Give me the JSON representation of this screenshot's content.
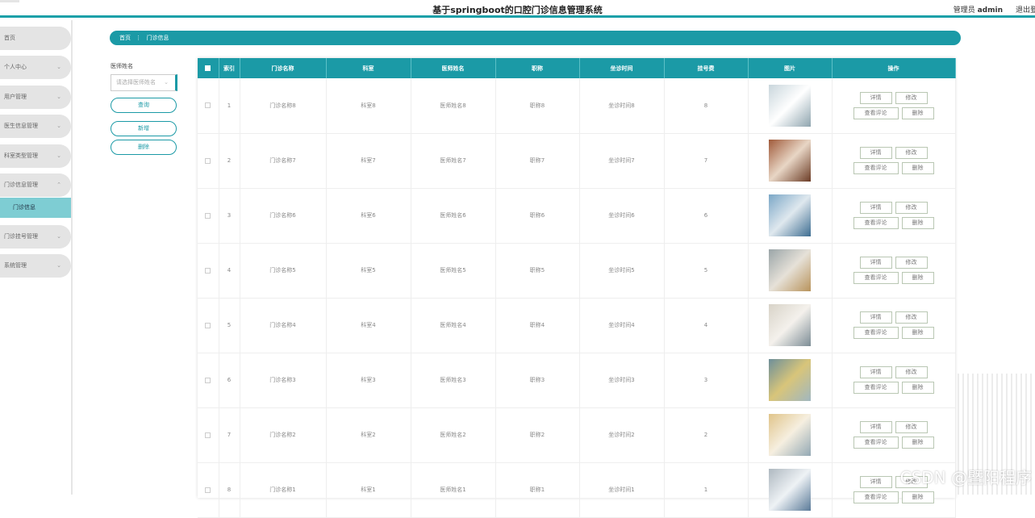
{
  "header": {
    "title": "基于springboot的口腔门诊信息管理系统",
    "admin_role": "管理员",
    "admin_name": "admin",
    "logout": "退出登录"
  },
  "sidebar": {
    "items": [
      {
        "label": "首页"
      },
      {
        "label": "个人中心"
      },
      {
        "label": "用户管理"
      },
      {
        "label": "医生信息管理"
      },
      {
        "label": "科室类型管理"
      },
      {
        "label": "门诊信息管理"
      },
      {
        "label": "门诊挂号管理"
      },
      {
        "label": "系统管理"
      }
    ],
    "active_sub": "门诊信息"
  },
  "breadcrumb": {
    "home": "首页",
    "sep": "⋮",
    "current": "门诊信息"
  },
  "filter": {
    "label": "医师姓名",
    "placeholder": "请选择医师姓名",
    "query": "查询",
    "add": "新增",
    "delete": "删除"
  },
  "table": {
    "columns": [
      "索引",
      "门诊名称",
      "科室",
      "医师姓名",
      "职称",
      "坐诊时间",
      "挂号费",
      "图片",
      "操作"
    ],
    "ops": {
      "detail": "详情",
      "edit": "修改",
      "view_comments": "查看评论",
      "delete": "删除"
    },
    "rows": [
      {
        "idx": "1",
        "name": "门诊名称8",
        "dept": "科室8",
        "doctor": "医师姓名8",
        "title": "职称8",
        "time": "坐诊时间8",
        "fee": "8"
      },
      {
        "idx": "2",
        "name": "门诊名称7",
        "dept": "科室7",
        "doctor": "医师姓名7",
        "title": "职称7",
        "time": "坐诊时间7",
        "fee": "7"
      },
      {
        "idx": "3",
        "name": "门诊名称6",
        "dept": "科室6",
        "doctor": "医师姓名6",
        "title": "职称6",
        "time": "坐诊时间6",
        "fee": "6"
      },
      {
        "idx": "4",
        "name": "门诊名称5",
        "dept": "科室5",
        "doctor": "医师姓名5",
        "title": "职称5",
        "time": "坐诊时间5",
        "fee": "5"
      },
      {
        "idx": "5",
        "name": "门诊名称4",
        "dept": "科室4",
        "doctor": "医师姓名4",
        "title": "职称4",
        "time": "坐诊时间4",
        "fee": "4"
      },
      {
        "idx": "6",
        "name": "门诊名称3",
        "dept": "科室3",
        "doctor": "医师姓名3",
        "title": "职称3",
        "time": "坐诊时间3",
        "fee": "3"
      },
      {
        "idx": "7",
        "name": "门诊名称2",
        "dept": "科室2",
        "doctor": "医师姓名2",
        "title": "职称2",
        "time": "坐诊时间2",
        "fee": "2"
      },
      {
        "idx": "8",
        "name": "门诊名称1",
        "dept": "科室1",
        "doctor": "医师姓名1",
        "title": "职称1",
        "time": "坐诊时间1",
        "fee": "1"
      }
    ]
  },
  "watermark": "CSDN @暨阳程序",
  "colors": {
    "accent": "#1b9aa6",
    "sub_active": "#7ecdd3"
  }
}
